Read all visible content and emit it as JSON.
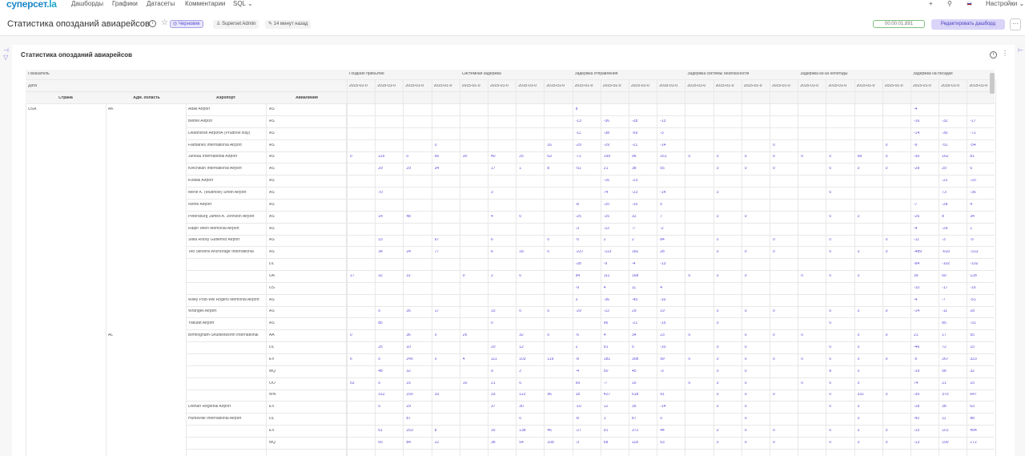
{
  "nav": {
    "logo_a": "суперсет",
    "logo_b": ".la",
    "items": [
      "Дашборды",
      "Графики",
      "Датасеты",
      "Комментарии",
      "SQL"
    ],
    "plus": "+",
    "settings": "Настройки"
  },
  "dashboard": {
    "title": "Статистика опозданий авиарейсов",
    "status": "Черновик",
    "owner": "Superset Admin",
    "modified": "14 минут назад",
    "timer": "00:00:01.891",
    "edit_label": "Редактировать дашборд",
    "more": "···"
  },
  "chart": {
    "title": "Статистика опозданий авиарейсов",
    "dots": "⋮",
    "metric_label": "Показатель",
    "date_label": "Дата",
    "metrics": [
      "Поздние прибытие",
      "Системная задержка",
      "Задержка отправления",
      "Задержка системы безопасности",
      "Задержка из-за непогоды",
      "Задержка на посадке"
    ],
    "dates": [
      "2015-01-0",
      "2015-01-0",
      "2015-01-0",
      "2015-01-0"
    ],
    "col_headers": [
      "Страна",
      "Адм. область",
      "Аэропорт",
      "Авиалиния"
    ],
    "rows": [
      {
        "country": "USA",
        "state": "AK",
        "airport": "Adak Airport",
        "airline": "AS",
        "v": [
          "",
          "",
          "",
          "",
          "",
          "",
          "",
          "",
          "8",
          "",
          "",
          "",
          "",
          "",
          "",
          "",
          "",
          "",
          "",
          "",
          "-4",
          "",
          ""
        ]
      },
      {
        "airport": "Bethel Airport",
        "airline": "AS",
        "v": [
          "",
          "",
          "",
          "",
          "",
          "",
          "",
          "",
          "-13",
          "-36",
          "-28",
          "-13",
          "",
          "",
          "",
          "",
          "",
          "",
          "",
          "",
          "-16",
          "-32",
          "-17"
        ]
      },
      {
        "airport": "Deadhorse AirportÂ (Prudhoe Bay)",
        "airline": "AS",
        "v": [
          "",
          "",
          "",
          "",
          "",
          "",
          "",
          "",
          "-11",
          "-38",
          "-59",
          "-3",
          "",
          "",
          "",
          "",
          "",
          "",
          "",
          "",
          "-14",
          "-30",
          "-72"
        ]
      },
      {
        "airport": "Fairbanks International Airport",
        "airline": "AS",
        "v": [
          "",
          "",
          "",
          "0",
          "",
          "",
          "",
          "16",
          "-29",
          "-29",
          "-21",
          "-14",
          "",
          "",
          "",
          "0",
          "",
          "",
          "",
          "0",
          "-9",
          "-51",
          "-54"
        ]
      },
      {
        "airport": "Juneau International Airport",
        "airline": "AS",
        "v": [
          "0",
          "119",
          "0",
          "66",
          "30",
          "40",
          "25",
          "63",
          "-71",
          "199",
          "96",
          "161",
          "0",
          "0",
          "0",
          "0",
          "0",
          "0",
          "68",
          "0",
          "-30",
          "162",
          "81"
        ]
      },
      {
        "airport": "Ketchikan International Airport",
        "airline": "AS",
        "v": [
          "",
          "29",
          "29",
          "34",
          "",
          "17",
          "1",
          "8",
          "-51",
          "21",
          "38",
          "55",
          "",
          "0",
          "0",
          "0",
          "",
          "0",
          "0",
          "0",
          "-28",
          "29",
          "6"
        ]
      },
      {
        "airport": "Kodiak Airport",
        "airline": "AS",
        "v": [
          "",
          "",
          "",
          "",
          "",
          "",
          "",
          "",
          "",
          "-16",
          "-23",
          "",
          "",
          "",
          "",
          "",
          "",
          "",
          "",
          "",
          "",
          "-22",
          "-20"
        ]
      },
      {
        "airport": "Merle K. (Mudhole) Smith Airport",
        "airline": "AS",
        "v": [
          "",
          "70",
          "",
          "",
          "",
          "3",
          "",
          "",
          "",
          "74",
          "-23",
          "-14",
          "",
          "0",
          "",
          "",
          "",
          "0",
          "",
          "",
          "",
          "73",
          "-36"
        ]
      },
      {
        "airport": "Nome Airport",
        "airline": "AS",
        "v": [
          "",
          "",
          "",
          "",
          "",
          "",
          "",
          "",
          "-8",
          "-20",
          "-10",
          "5",
          "",
          "",
          "",
          "",
          "",
          "",
          "",
          "",
          "-7",
          "-28",
          "4"
        ]
      },
      {
        "airport": "Petersburg James A. Johnson Airport",
        "airline": "AS",
        "v": [
          "",
          "14",
          "48",
          "",
          "",
          "4",
          "0",
          "",
          "-25",
          "-25",
          "32",
          "7",
          "",
          "0",
          "0",
          "",
          "",
          "0",
          "0",
          "",
          "-26",
          "8",
          "34"
        ]
      },
      {
        "airport": "Ralph Wien Memorial Airport",
        "airline": "AS",
        "v": [
          "",
          "",
          "",
          "",
          "",
          "",
          "",
          "",
          "-3",
          "-22",
          "-7",
          "-2",
          "",
          "",
          "",
          "",
          "",
          "",
          "",
          "",
          "-4",
          "-29",
          "1"
        ]
      },
      {
        "airport": "Sitka Rocky Gutierrez Airport",
        "airline": "AS",
        "v": [
          "",
          "15",
          "",
          "67",
          "",
          "6",
          "",
          "0",
          "-5",
          "2",
          "2",
          "84",
          "",
          "0",
          "",
          "0",
          "",
          "0",
          "",
          "0",
          "-11",
          "-3",
          "-5"
        ]
      },
      {
        "airport": "Ted Stevens Anchorage International",
        "airline": "AS",
        "v": [
          "",
          "34",
          "24",
          "77",
          "",
          "6",
          "18",
          "0",
          "-237",
          "-113",
          "182",
          "28",
          "",
          "0",
          "0",
          "0",
          "",
          "0",
          "0",
          "0",
          "-489",
          "-610",
          "-313"
        ]
      },
      {
        "airline": "DL",
        "v": [
          "",
          "",
          "",
          "",
          "",
          "",
          "",
          "",
          "-28",
          "-9",
          "-4",
          "-13",
          "",
          "",
          "",
          "",
          "",
          "",
          "",
          "",
          "-84",
          "-102",
          "-102"
        ]
      },
      {
        "airline": "UA",
        "v": [
          "17",
          "32",
          "31",
          "",
          "0",
          "2",
          "0",
          "",
          "94",
          "111",
          "168",
          "",
          "0",
          "0",
          "0",
          "",
          "0",
          "0",
          "0",
          "",
          "39",
          "60",
          "128"
        ]
      },
      {
        "airline": "US",
        "v": [
          "",
          "",
          "",
          "",
          "",
          "",
          "",
          "",
          "-9",
          "4",
          "11",
          "4",
          "",
          "",
          "",
          "",
          "",
          "",
          "",
          "",
          "-10",
          "-17",
          "-16"
        ]
      },
      {
        "airport": "Wiley Post-Will Rogers Memorial Airport",
        "airline": "AS",
        "v": [
          "",
          "",
          "",
          "",
          "",
          "",
          "",
          "",
          "0",
          "-36",
          "-45",
          "-10",
          "",
          "",
          "",
          "",
          "",
          "",
          "",
          "",
          "-4",
          "-7",
          "-51"
        ]
      },
      {
        "airport": "Wrangell Airport",
        "airline": "AS",
        "v": [
          "",
          "0",
          "35",
          "17",
          "",
          "15",
          "0",
          "0",
          "-29",
          "-22",
          "29",
          "19",
          "",
          "0",
          "0",
          "0",
          "",
          "0",
          "0",
          "0",
          "-14",
          "-11",
          "18"
        ]
      },
      {
        "airport": "Yakutat Airport",
        "airline": "AS",
        "v": [
          "",
          "85",
          "",
          "",
          "",
          "0",
          "",
          "",
          "",
          "96",
          "-21",
          "-15",
          "",
          "0",
          "",
          "",
          "",
          "0",
          "",
          "",
          "",
          "85",
          "-31"
        ]
      },
      {
        "state": "AL",
        "airport": "Birmingham-Shuttlesworth International",
        "airline": "AA",
        "v": [
          "0",
          "",
          "36",
          "0",
          "26",
          "",
          "32",
          "0",
          "-5",
          "4",
          "34",
          "23",
          "0",
          "",
          "0",
          "0",
          "0",
          "",
          "0",
          "0",
          "21",
          "17",
          "55"
        ]
      },
      {
        "airline": "DL",
        "v": [
          "",
          "25",
          "10",
          "",
          "",
          "20",
          "12",
          "",
          "2",
          "91",
          "5",
          "-10",
          "",
          "0",
          "0",
          "",
          "",
          "0",
          "0",
          "",
          "-46",
          "72",
          "15"
        ]
      },
      {
        "airline": "EV",
        "v": [
          "6",
          "0",
          "245",
          "0",
          "4",
          "111",
          "103",
          "119",
          "-8",
          "181",
          "308",
          "99",
          "0",
          "0",
          "0",
          "0",
          "0",
          "0",
          "0",
          "0",
          "-5",
          "267",
          "323"
        ]
      },
      {
        "airline": "MQ",
        "v": [
          "",
          "48",
          "32",
          "",
          "",
          "9",
          "2",
          "",
          "-4",
          "50",
          "45",
          "-3",
          "",
          "0",
          "0",
          "",
          "",
          "8",
          "0",
          "",
          "-19",
          "58",
          "32"
        ]
      },
      {
        "airline": "OO",
        "v": [
          "53",
          "0",
          "15",
          "",
          "10",
          "21",
          "0",
          "",
          "69",
          "-7",
          "16",
          "",
          "0",
          "0",
          "0",
          "",
          "0",
          "0",
          "0",
          "",
          "74",
          "21",
          "15"
        ]
      },
      {
        "airline": "WN",
        "v": [
          "",
          "312",
          "150",
          "33",
          "",
          "33",
          "113",
          "96",
          "18",
          "427",
          "618",
          "91",
          "",
          "0",
          "0",
          "0",
          "",
          "0",
          "331",
          "0",
          "-30",
          "370",
          "647"
        ]
      },
      {
        "airport": "Dothan Regional Airport",
        "airline": "EV",
        "v": [
          "",
          "0",
          "29",
          "",
          "",
          "37",
          "30",
          "",
          "-10",
          "12",
          "35",
          "-14",
          "",
          "0",
          "0",
          "",
          "",
          "0",
          "0",
          "",
          "-18",
          "38",
          "63"
        ]
      },
      {
        "airport": "Huntsville International Airport",
        "airline": "DL",
        "v": [
          "",
          "",
          "87",
          "",
          "",
          "",
          "0",
          "",
          "-8",
          "1",
          "87",
          "0",
          "",
          "",
          "0",
          "",
          "",
          "",
          "0",
          "",
          "-42",
          "11",
          "88"
        ]
      },
      {
        "airline": "EV",
        "v": [
          "",
          "61",
          "253",
          "8",
          "",
          "16",
          "138",
          "46",
          "-27",
          "91",
          "372",
          "44",
          "",
          "0",
          "0",
          "0",
          "",
          "0",
          "0",
          "0",
          "-15",
          "101",
          "494"
        ]
      },
      {
        "airline": "MQ",
        "v": [
          "",
          "65",
          "84",
          "22",
          "",
          "38",
          "54",
          "108",
          "-3",
          "68",
          "118",
          "53",
          "",
          "0",
          "0",
          "0",
          "",
          "0",
          "0",
          "0",
          "-13",
          "100",
          "172"
        ]
      }
    ]
  }
}
